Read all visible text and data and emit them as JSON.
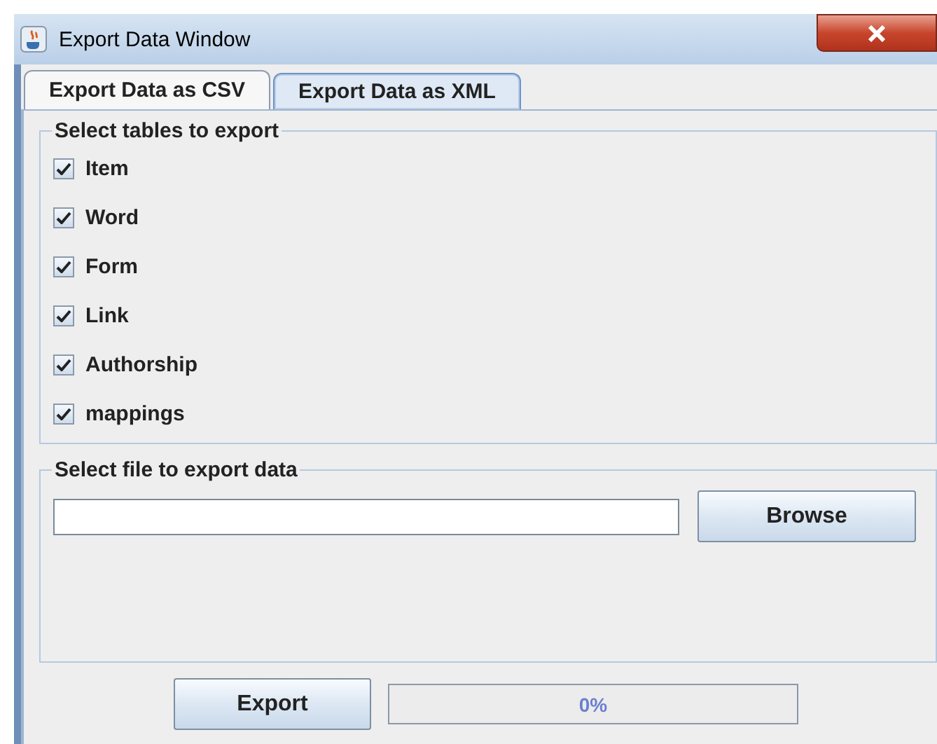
{
  "window": {
    "title": "Export Data Window"
  },
  "tabs": [
    {
      "label": "Export Data as CSV",
      "selected": true
    },
    {
      "label": "Export Data as XML",
      "selected": false
    }
  ],
  "tables_group": {
    "title": "Select tables to export",
    "items": [
      {
        "label": "Item",
        "checked": true
      },
      {
        "label": "Word",
        "checked": true
      },
      {
        "label": "Form",
        "checked": true
      },
      {
        "label": "Link",
        "checked": true
      },
      {
        "label": "Authorship",
        "checked": true
      },
      {
        "label": "mappings",
        "checked": true
      }
    ]
  },
  "file_group": {
    "title": "Select file to export data",
    "browse_button": "Browse"
  },
  "export_button": "Export",
  "progress": {
    "level": 0,
    "reading": "0%"
  }
}
